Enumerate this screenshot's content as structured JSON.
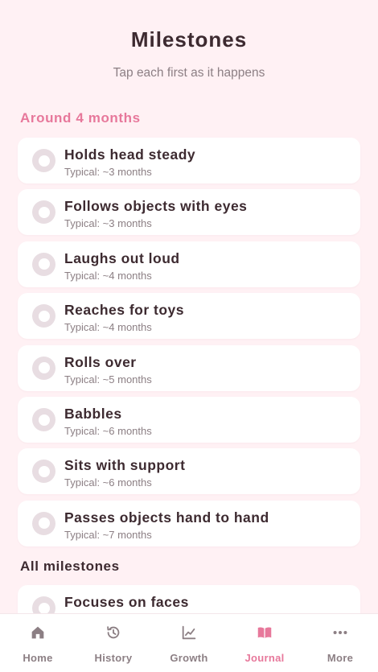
{
  "header": {
    "title": "Milestones",
    "subtitle": "Tap each first as it happens"
  },
  "sections": {
    "current": "Around 4 months",
    "all": "All milestones"
  },
  "milestones": [
    {
      "title": "Holds head steady",
      "typical": "Typical: ~3 months",
      "done": false
    },
    {
      "title": "Follows objects with eyes",
      "typical": "Typical: ~3 months",
      "done": false
    },
    {
      "title": "Laughs out loud",
      "typical": "Typical: ~4 months",
      "done": false
    },
    {
      "title": "Reaches for toys",
      "typical": "Typical: ~4 months",
      "done": false
    },
    {
      "title": "Rolls over",
      "typical": "Typical: ~5 months",
      "done": false
    },
    {
      "title": "Babbles",
      "typical": "Typical: ~6 months",
      "done": false
    },
    {
      "title": "Sits with support",
      "typical": "Typical: ~6 months",
      "done": false
    },
    {
      "title": "Passes objects hand to hand",
      "typical": "Typical: ~7 months",
      "done": false
    }
  ],
  "all_milestones": [
    {
      "title": "Focuses on faces",
      "done": false
    }
  ],
  "tabbar": {
    "items": [
      {
        "label": "Home",
        "icon": "home-icon",
        "active": false
      },
      {
        "label": "History",
        "icon": "history-icon",
        "active": false
      },
      {
        "label": "Growth",
        "icon": "growth-chart-icon",
        "active": false
      },
      {
        "label": "Journal",
        "icon": "journal-book-icon",
        "active": true
      },
      {
        "label": "More",
        "icon": "more-dots-icon",
        "active": false
      }
    ]
  },
  "colors": {
    "accent": "#e7789b",
    "background": "#fff1f4",
    "text": "#3d2a30",
    "muted": "#8c7f84",
    "check_ring": "#e8dde2"
  }
}
